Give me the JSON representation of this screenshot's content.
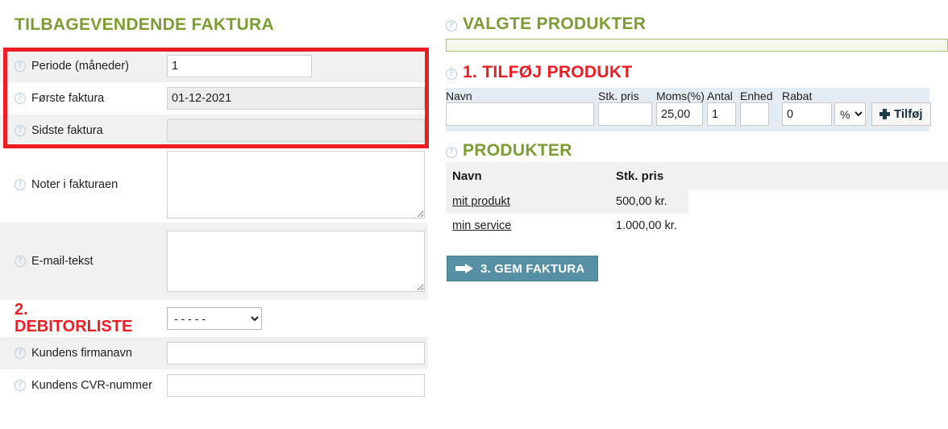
{
  "left": {
    "title": "TILBAGEVENDENDE FAKTURA",
    "help_glyph": "?",
    "rows": [
      {
        "label": "Periode (måneder)",
        "value": "1",
        "placeholder": ""
      },
      {
        "label": "Første faktura",
        "value": "01-12-2021",
        "placeholder": ""
      },
      {
        "label": "Sidste faktura",
        "value": "",
        "placeholder": ""
      },
      {
        "label": "Noter i fakturaen",
        "value": "",
        "placeholder": ""
      },
      {
        "label": "E-mail-tekst",
        "value": "",
        "placeholder": ""
      }
    ],
    "debtor": {
      "title_line1": "2.",
      "title_line2": "DEBITORLISTE",
      "select_value": "- - - - -",
      "select_options": [
        "- - - - -"
      ],
      "fields": [
        {
          "label": "Kundens firmanavn",
          "value": "",
          "placeholder": ""
        },
        {
          "label": "Kundens CVR-nummer",
          "value": "",
          "placeholder": ""
        }
      ]
    }
  },
  "right": {
    "selected_products_title": "VALGTE PRODUKTER",
    "add_product_title": "1. TILFØJ PRODUKT",
    "add_form": {
      "headers": {
        "navn": "Navn",
        "pris": "Stk. pris",
        "moms": "Moms(%)",
        "antal": "Antal",
        "enhed": "Enhed",
        "rabat": "Rabat"
      },
      "values": {
        "navn": "",
        "pris": "",
        "moms": "25,00",
        "antal": "1",
        "enhed": "",
        "rabat": "0",
        "rabat_unit": "%"
      },
      "rabat_unit_options": [
        "%"
      ],
      "add_button_label": "Tilføj"
    },
    "products_title": "PRODUKTER",
    "products_table": {
      "columns": [
        "Navn",
        "Stk. pris"
      ],
      "rows": [
        {
          "navn": "mit produkt",
          "pris": "500,00 kr."
        },
        {
          "navn": "min service",
          "pris": "1.000,00 kr."
        }
      ]
    },
    "save_button_label": "3. GEM FAKTURA"
  },
  "colors": {
    "green_heading": "#7d9c33",
    "red_heading": "#ee1c23",
    "highlight_border": "#ee1c23",
    "save_button": "#578fa4",
    "toolbar_background": "#e4ecf2",
    "row_shade": "#f1f1f1"
  }
}
